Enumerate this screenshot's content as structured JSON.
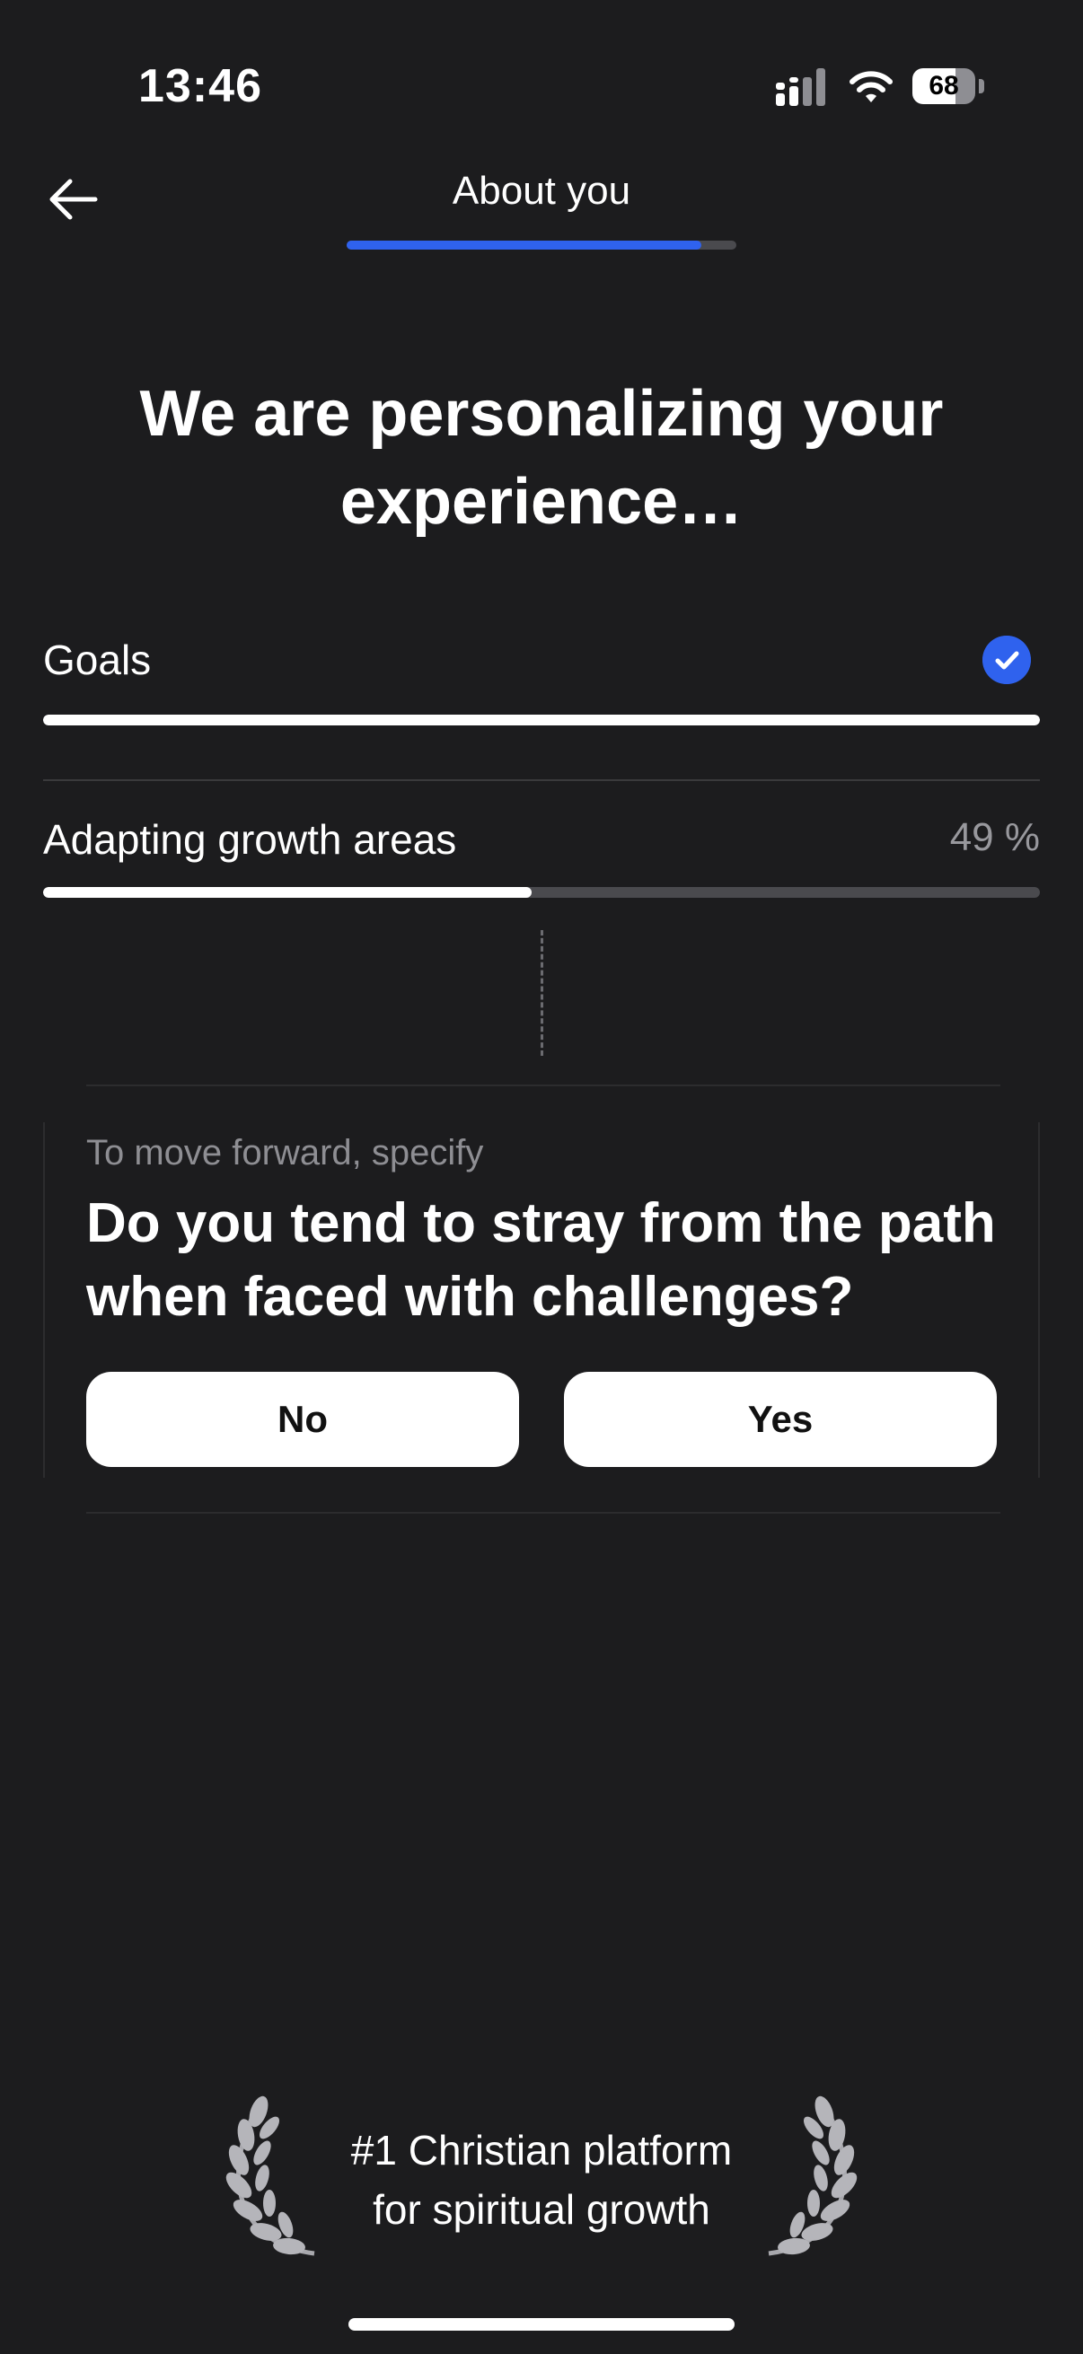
{
  "status_bar": {
    "time": "13:46",
    "battery": "68"
  },
  "header": {
    "title": "About you",
    "progress": 0.91
  },
  "headline": "We are personalizing your experience…",
  "steps": [
    {
      "label": "Goals",
      "progress": 1.0,
      "done": true
    },
    {
      "label": "Adapting growth areas",
      "progress": 0.49,
      "percent_text": "49 %"
    }
  ],
  "question": {
    "hint": "To move forward, specify",
    "text": "Do you tend to stray from the path when faced with challenges?",
    "options": [
      "No",
      "Yes"
    ]
  },
  "footer": {
    "line1": "#1 Christian platform",
    "line2": "for spiritual growth"
  },
  "colors": {
    "accent": "#2f62ee",
    "background": "#1c1c1e",
    "track": "#4a4a4e"
  }
}
